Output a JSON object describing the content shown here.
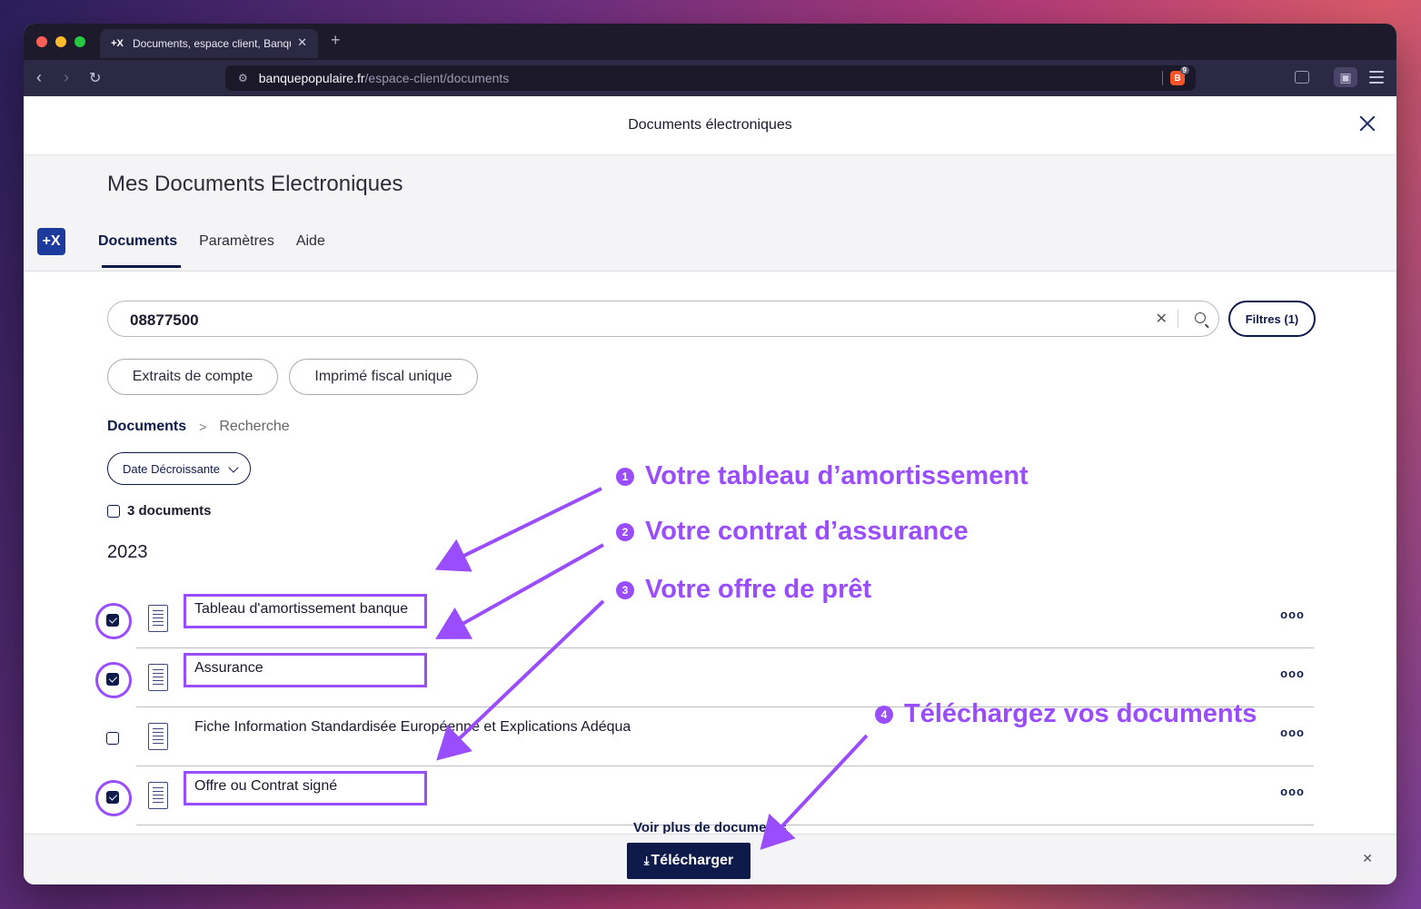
{
  "browser": {
    "tab_title": "Documents, espace client, Banque",
    "tab_favicon": "+X",
    "new_tab": "+",
    "url_host": "banquepopulaire.fr",
    "url_path": "/espace-client/documents",
    "brave_badge": "9"
  },
  "modal": {
    "title": "Documents électroniques"
  },
  "header": {
    "heading": "Mes Documents Electroniques",
    "logo": "+X",
    "tabs": [
      {
        "label": "Documents",
        "active": true
      },
      {
        "label": "Paramètres",
        "active": false
      },
      {
        "label": "Aide",
        "active": false
      }
    ]
  },
  "search": {
    "value": "08877500",
    "filters_label": "Filtres (1)"
  },
  "chips": [
    "Extraits de compte",
    "Imprimé fiscal unique"
  ],
  "breadcrumb": {
    "root": "Documents",
    "current": "Recherche"
  },
  "sort": {
    "selected": "Date Décroissante"
  },
  "results": {
    "count_label": "3 documents",
    "year": "2023",
    "documents": [
      {
        "name": "Tableau d'amortissement banque",
        "checked": true
      },
      {
        "name": "Assurance",
        "checked": true
      },
      {
        "name": "Fiche Information Standardisée Européenne et Explications Adéqua",
        "checked": false
      },
      {
        "name": "Offre ou Contrat signé",
        "checked": true
      }
    ],
    "more_label": "ooo"
  },
  "footer": {
    "see_more": "Voir plus de documents",
    "download_label": "Télécharger"
  },
  "annotations": [
    {
      "num": "1",
      "text": "Votre tableau d’amortissement"
    },
    {
      "num": "2",
      "text": "Votre contrat d’assurance"
    },
    {
      "num": "3",
      "text": "Votre offre de prêt"
    },
    {
      "num": "4",
      "text": "Téléchargez vos documents"
    }
  ],
  "colors": {
    "annotation": "#9a4dff",
    "brand_navy": "#0d1a4a",
    "logo_blue": "#1c3b9c"
  }
}
